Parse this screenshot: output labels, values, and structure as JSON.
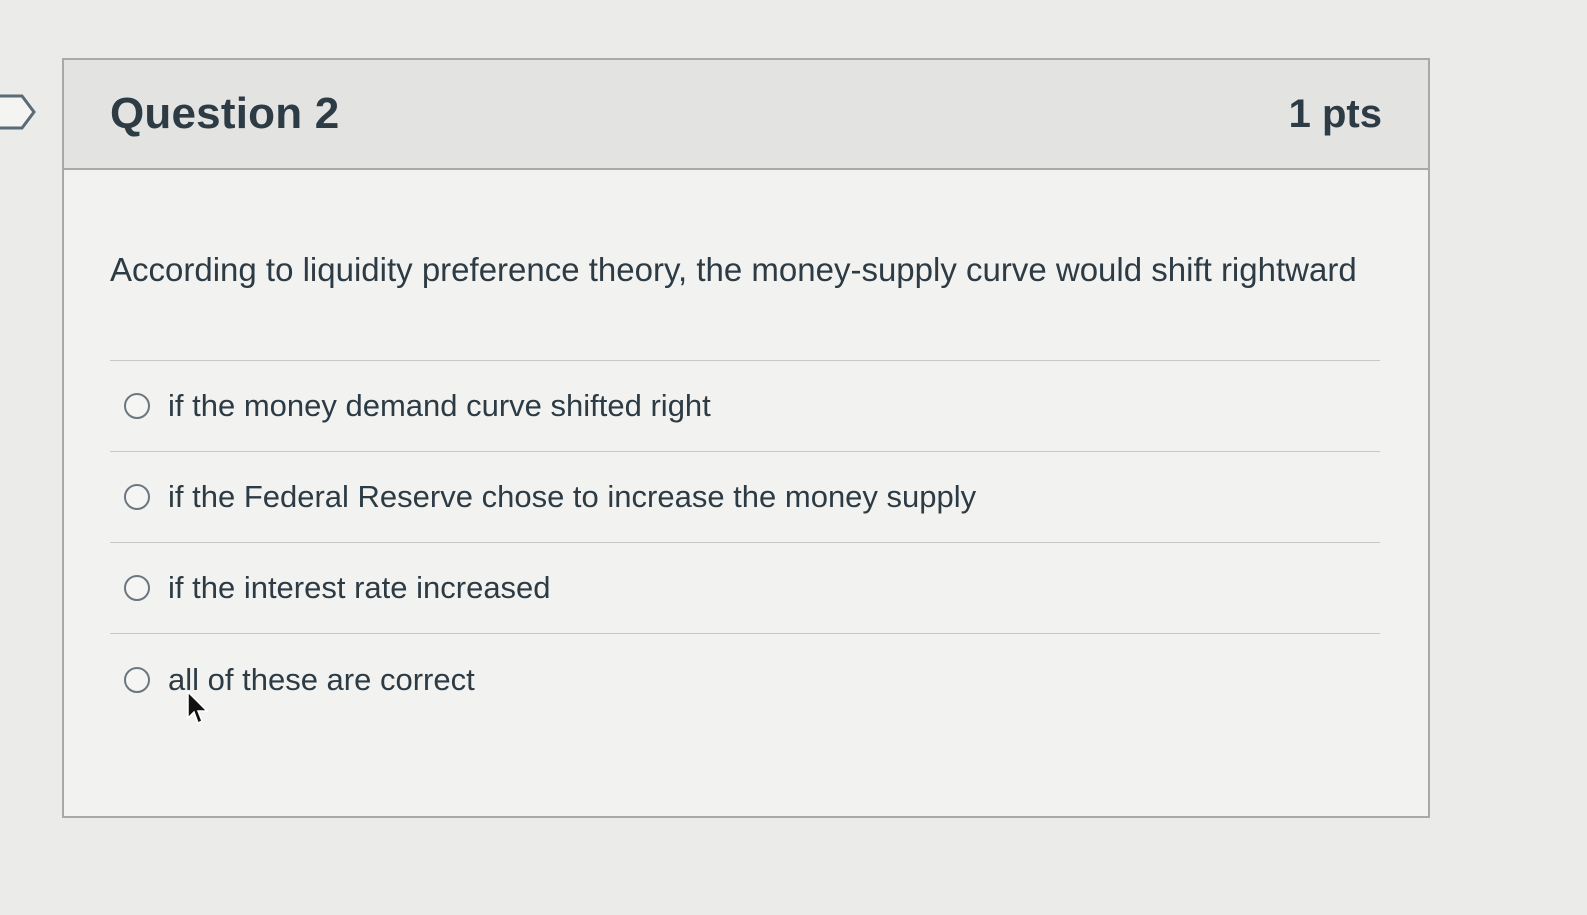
{
  "question": {
    "title": "Question 2",
    "points": "1 pts",
    "text": "According to liquidity preference theory, the money-supply curve would shift rightward",
    "answers": [
      {
        "label": "if the money demand curve shifted right",
        "selected": false
      },
      {
        "label": "if the Federal Reserve chose to increase the money supply",
        "selected": false
      },
      {
        "label": "if the interest rate increased",
        "selected": false
      },
      {
        "label": "all of these are correct",
        "selected": false
      }
    ]
  },
  "icons": {
    "flag": "bookmark-flag-icon",
    "radio": "radio-unselected-icon",
    "cursor": "mouse-pointer-icon"
  },
  "colors": {
    "page_background": "#ebebea",
    "header_background": "#e3e3e2",
    "card_background": "#f2f2f1",
    "border": "#a9aaa8",
    "text": "#2d3b45"
  }
}
